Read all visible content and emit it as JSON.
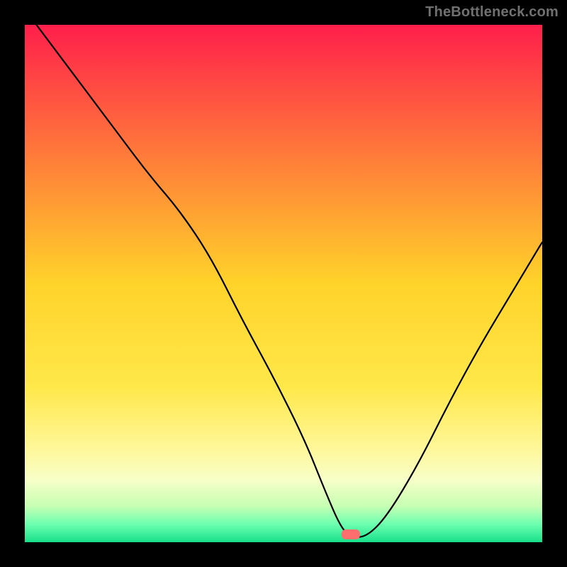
{
  "watermark": "TheBottleneck.com",
  "chart_data": {
    "type": "line",
    "title": "",
    "xlabel": "",
    "ylabel": "",
    "xlim": [
      0,
      100
    ],
    "ylim": [
      0,
      100
    ],
    "grid": false,
    "legend": false,
    "gradient_stops": [
      {
        "offset": 0.0,
        "color": "#ff1f4b"
      },
      {
        "offset": 0.25,
        "color": "#ff7a3a"
      },
      {
        "offset": 0.5,
        "color": "#ffd32a"
      },
      {
        "offset": 0.7,
        "color": "#ffe84a"
      },
      {
        "offset": 0.82,
        "color": "#fff79a"
      },
      {
        "offset": 0.88,
        "color": "#f7ffc8"
      },
      {
        "offset": 0.93,
        "color": "#c7ffb3"
      },
      {
        "offset": 0.965,
        "color": "#6dffb0"
      },
      {
        "offset": 1.0,
        "color": "#18e08a"
      }
    ],
    "marker": {
      "x": 63,
      "y": 1.5,
      "color": "#ff6e6e"
    },
    "series": [
      {
        "name": "bottleneck-curve",
        "x": [
          0,
          6,
          12,
          18,
          24,
          30,
          36,
          42,
          48,
          54,
          58,
          61,
          63,
          66,
          70,
          76,
          82,
          88,
          94,
          100
        ],
        "y": [
          103,
          95,
          87,
          79,
          71,
          64,
          55,
          43,
          32,
          20,
          10,
          3,
          1,
          1,
          5,
          15,
          27,
          38,
          48,
          58
        ]
      }
    ]
  }
}
